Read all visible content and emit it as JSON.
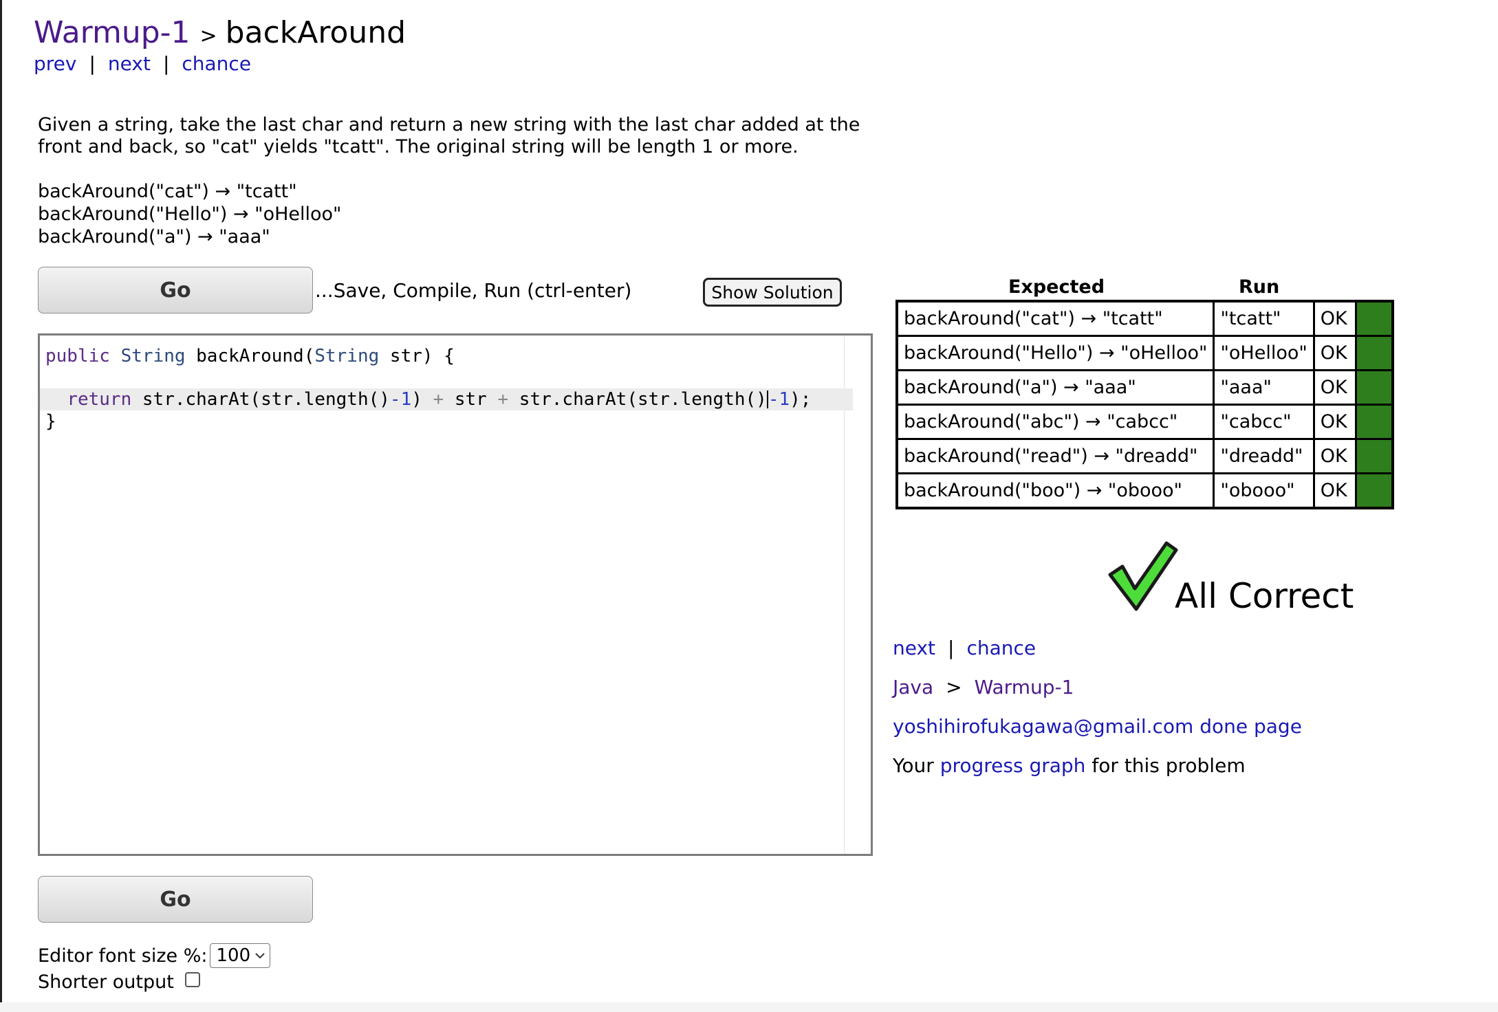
{
  "header": {
    "section_link": "Warmup-1",
    "separator": ">",
    "problem_title": "backAround"
  },
  "top_nav": {
    "prev": "prev",
    "next": "next",
    "chance": "chance",
    "divider": "|"
  },
  "statement": "Given a string, take the last char and return a new string with the last char added at the front and back, so \"cat\" yields \"tcatt\". The original string will be length 1 or more.",
  "examples": [
    "backAround(\"cat\") → \"tcatt\"",
    "backAround(\"Hello\") → \"oHelloo\"",
    "backAround(\"a\") → \"aaa\""
  ],
  "toolbar": {
    "go_label": "Go",
    "save_hint": "...Save, Compile, Run (ctrl-enter)",
    "show_solution_label": "Show Solution"
  },
  "editor": {
    "line1": {
      "kw": "public",
      "type1": "String",
      "name": "backAround(",
      "type2": "String",
      "rest": "str) {"
    },
    "line2": {
      "kw": "return",
      "a": "str.charAt(str.length()",
      "minus1": "-1",
      "b": ")",
      "plus1": "+",
      "c": "str",
      "plus2": "+",
      "d": "str.charAt(str.length()",
      "minus2": "-1",
      "e": ");"
    },
    "line3": "}"
  },
  "options": {
    "font_size_label": "Editor font size %:",
    "font_size_value": "100",
    "shorter_output_label": "Shorter output",
    "shorter_output_checked": false
  },
  "results": {
    "expected_header": "Expected",
    "run_header": "Run",
    "bar_color": "#2f7e1e",
    "rows": [
      {
        "expected": "backAround(\"cat\") → \"tcatt\"",
        "run": "\"tcatt\"",
        "status": "OK"
      },
      {
        "expected": "backAround(\"Hello\") → \"oHelloo\"",
        "run": "\"oHelloo\"",
        "status": "OK"
      },
      {
        "expected": "backAround(\"a\") → \"aaa\"",
        "run": "\"aaa\"",
        "status": "OK"
      },
      {
        "expected": "backAround(\"abc\") → \"cabcc\"",
        "run": "\"cabcc\"",
        "status": "OK"
      },
      {
        "expected": "backAround(\"read\") → \"dreadd\"",
        "run": "\"dreadd\"",
        "status": "OK"
      },
      {
        "expected": "backAround(\"boo\") → \"obooo\"",
        "run": "\"obooo\"",
        "status": "OK"
      }
    ]
  },
  "result_summary": {
    "icon": "green-check-icon",
    "text": "All Correct"
  },
  "bottom_nav": {
    "next": "next",
    "chance": "chance",
    "divider": "|"
  },
  "lang_crumb": {
    "lang": "Java",
    "separator": ">",
    "section": "Warmup-1"
  },
  "done_page_link": "yoshihirofukagawa@gmail.com done page",
  "progress": {
    "prefix": "Your",
    "link": "progress graph",
    "suffix": "for this problem"
  },
  "colors": {
    "section_link": "#4b1b8a",
    "link": "#1a1ab4",
    "ok_bar": "#2f7e1e",
    "check_fill": "#4ddc3a"
  }
}
